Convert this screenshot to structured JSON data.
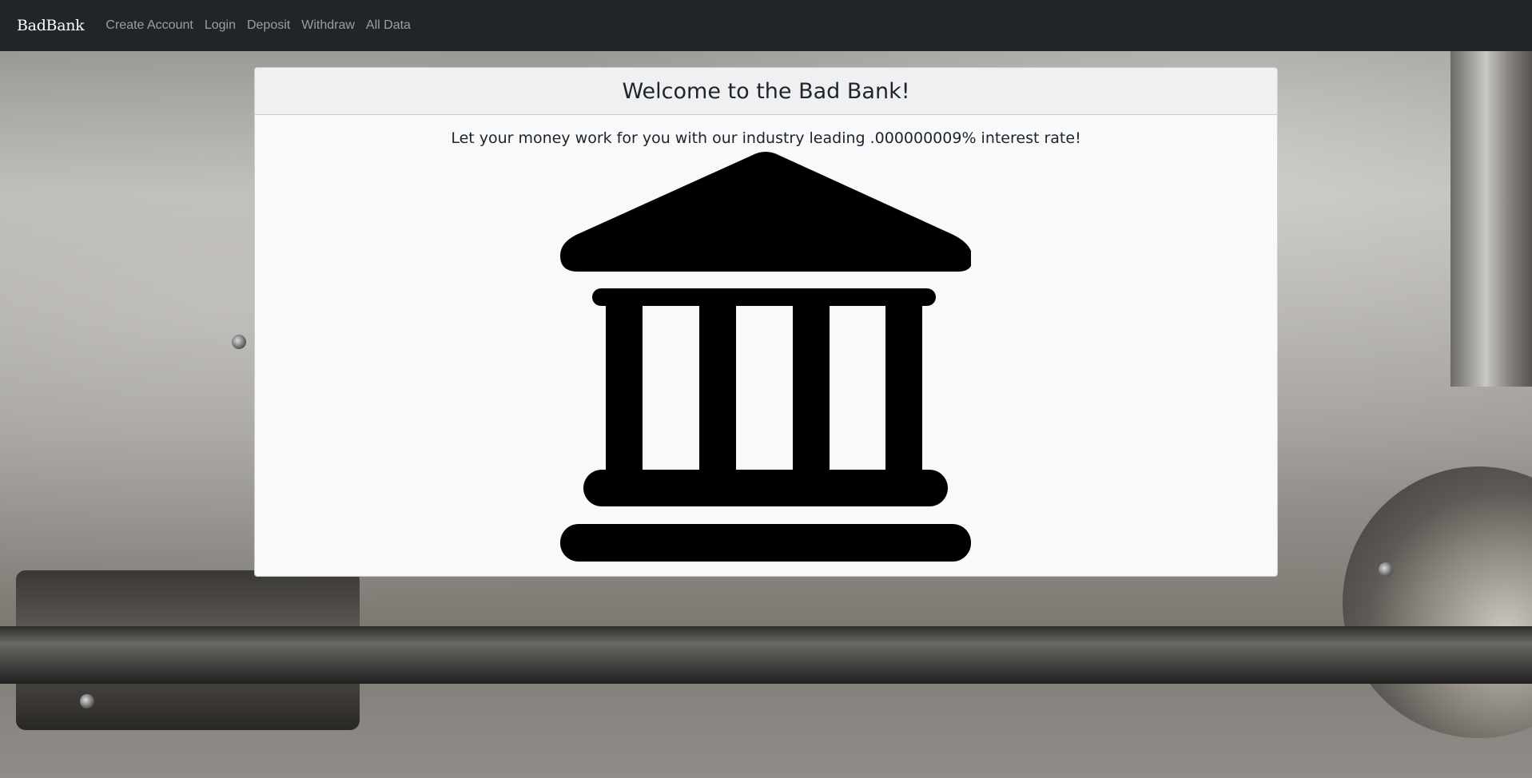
{
  "navbar": {
    "brand": "BadBank",
    "links": [
      {
        "label": "Create Account"
      },
      {
        "label": "Login"
      },
      {
        "label": "Deposit"
      },
      {
        "label": "Withdraw"
      },
      {
        "label": "All Data"
      }
    ]
  },
  "card": {
    "title": "Welcome to the Bad Bank!",
    "text": "Let your money work for you with our industry leading .000000009% interest rate!",
    "image_icon": "bank-icon"
  },
  "background": {
    "image": "bank-vault-door",
    "navbar_color": "#212529",
    "card_color": "#f8f9fa"
  }
}
